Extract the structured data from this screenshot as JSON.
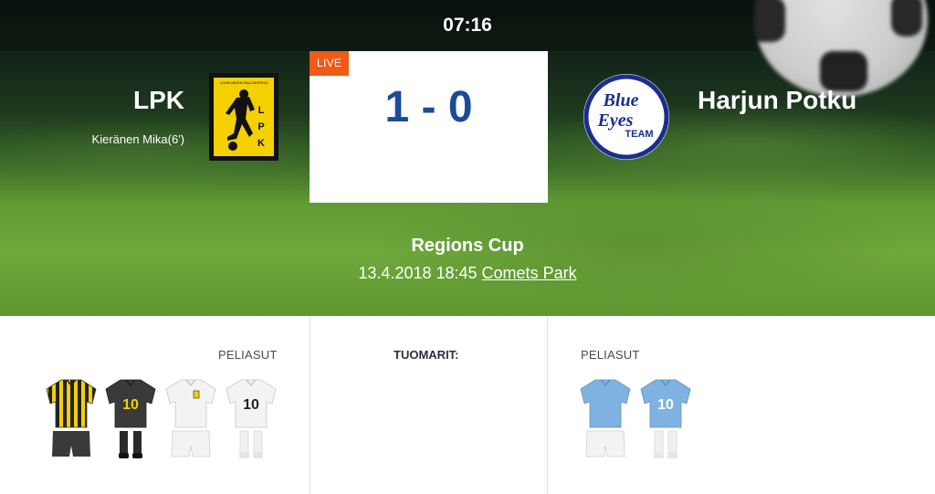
{
  "match": {
    "clock": "07:16",
    "status": "LIVE",
    "score": "1 - 0",
    "competition": "Regions Cup",
    "datetime": "13.4.2018 18:45",
    "venue": "Comets Park"
  },
  "home": {
    "name": "LPK",
    "scorers": [
      "Kieränen Mika(6')"
    ],
    "logo_letters": [
      "L",
      "P",
      "K"
    ],
    "logo_caption": "LOHKOSKEN PALLOKERHO",
    "kits_label": "PELIASUT",
    "kits": [
      {
        "name": "home-striped-kit",
        "number": ""
      },
      {
        "name": "home-black-kit",
        "number": "10"
      },
      {
        "name": "away-white-kit",
        "number": ""
      },
      {
        "name": "away-white-kit-numbered",
        "number": "10"
      }
    ]
  },
  "away": {
    "name": "Harjun Potku",
    "logo_text": [
      "Blue",
      "Eyes",
      "TEAM"
    ],
    "kits_label": "PELIASUT",
    "kits": [
      {
        "name": "home-lightblue-kit",
        "number": ""
      },
      {
        "name": "home-lightblue-kit-numbered",
        "number": "10"
      }
    ]
  },
  "officials": {
    "label": "TUOMARIT:"
  },
  "colors": {
    "live_badge": "#f05a16",
    "score": "#1c4a9c",
    "home_yellow": "#f4d000",
    "away_blue": "#1a2e8c",
    "kit_lightblue": "#7fb2e0"
  }
}
